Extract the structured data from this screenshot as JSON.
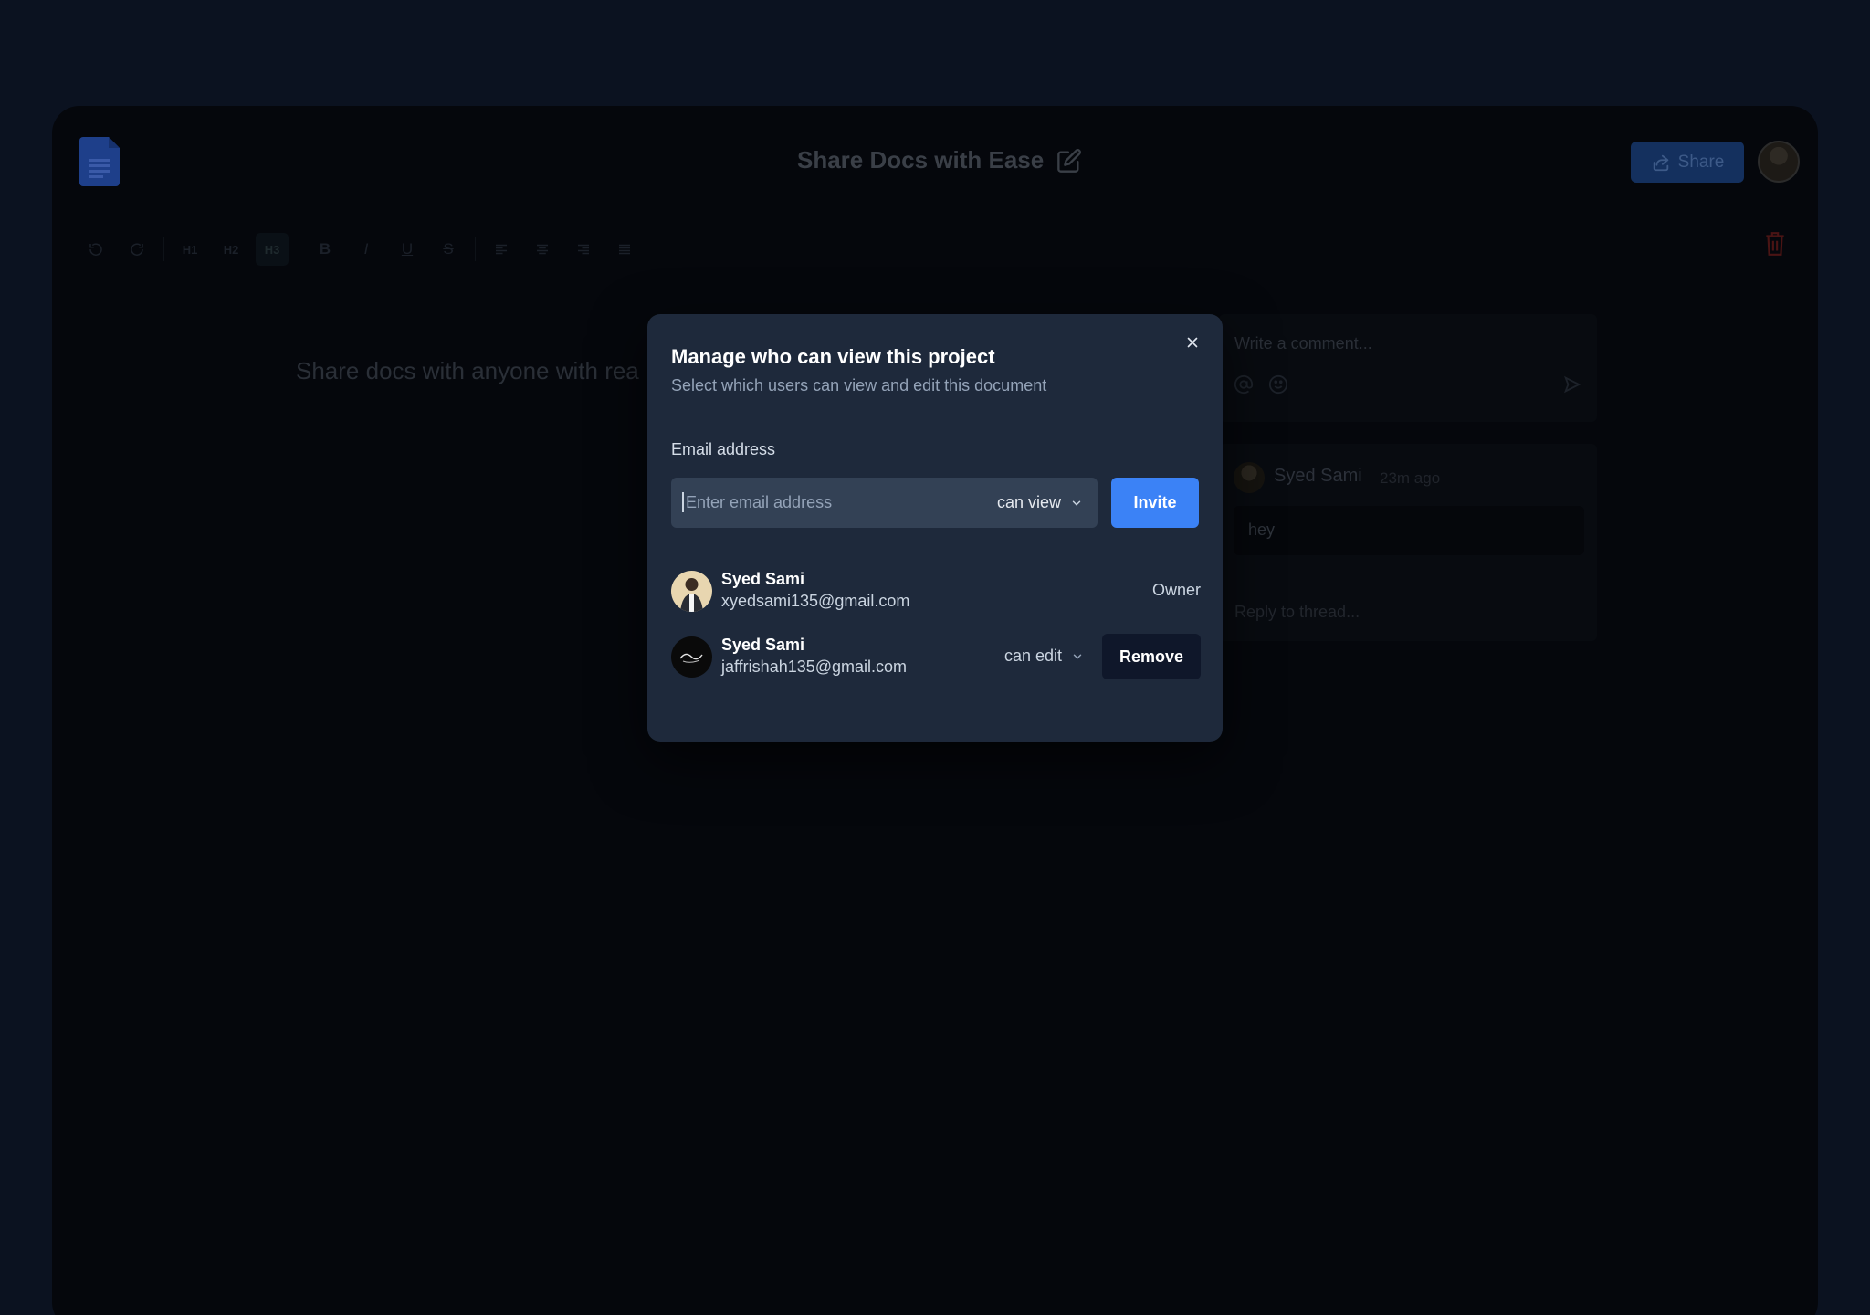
{
  "header": {
    "doc_title": "Share Docs with Ease",
    "share_label": "Share"
  },
  "toolbar": {
    "h1": "H1",
    "h2": "H2",
    "h3": "H3",
    "bold": "B",
    "italic": "I",
    "underline": "U",
    "strike": "S"
  },
  "editor": {
    "text": "Share docs with anyone with rea"
  },
  "comments": {
    "placeholder": "Write a comment...",
    "thread": {
      "author": "Syed Sami",
      "time": "23m ago",
      "message": "hey",
      "reply_placeholder": "Reply to thread..."
    }
  },
  "modal": {
    "title": "Manage who can view this project",
    "subtitle": "Select which users can view and edit this document",
    "email_label": "Email address",
    "email_placeholder": "Enter email address",
    "email_value": "",
    "permission": "can view",
    "invite_label": "Invite",
    "users": [
      {
        "name": "Syed Sami",
        "email": "xyedsami135@gmail.com",
        "role": "Owner"
      },
      {
        "name": "Syed Sami",
        "email": "jaffrishah135@gmail.com",
        "permission": "can edit",
        "remove_label": "Remove"
      }
    ]
  },
  "colors": {
    "accent": "#3b82f6",
    "modal_bg": "#1e293b",
    "input_bg": "#334155",
    "page_bg": "#0b1220"
  }
}
